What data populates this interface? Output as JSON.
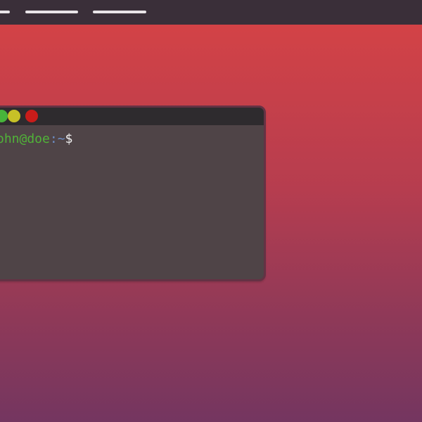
{
  "topbar": {
    "items": [
      {
        "label": ""
      },
      {
        "label": ""
      },
      {
        "label": ""
      }
    ]
  },
  "terminal": {
    "prompt_user_host": "ohn@doe",
    "prompt_path": ":~",
    "prompt_symbol": "$"
  },
  "colors": {
    "background_top": "#d74345",
    "background_bottom": "#743660",
    "topbar": "#3a2f39",
    "terminal_body": "#4f4447",
    "terminal_titlebar": "#2e2b2e",
    "prompt_user": "#50b338",
    "prompt_path": "#6d8fc8",
    "close_button": "#c91c1a",
    "minimize_button": "#c7c127",
    "maximize_button": "#47b53b"
  },
  "icons": {
    "window_controls": [
      "maximize-icon",
      "minimize-icon",
      "close-icon"
    ]
  }
}
